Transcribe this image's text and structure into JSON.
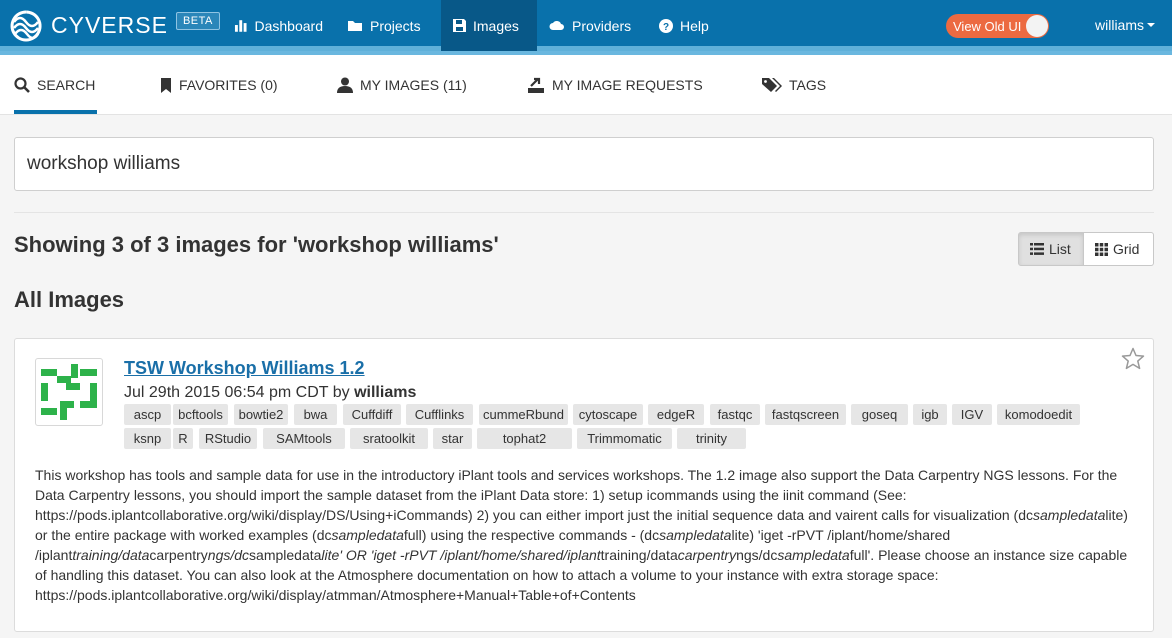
{
  "brand": {
    "name": "CYVERSE",
    "badge": "BETA"
  },
  "nav": {
    "items": [
      {
        "label": "Dashboard",
        "icon": "bar-chart-icon"
      },
      {
        "label": "Projects",
        "icon": "folder-icon"
      },
      {
        "label": "Images",
        "icon": "floppy-disk-icon",
        "active": true
      },
      {
        "label": "Providers",
        "icon": "cloud-icon"
      },
      {
        "label": "Help",
        "icon": "question-circle-icon"
      }
    ],
    "old_ui_label": "View Old UI",
    "user": "williams"
  },
  "tabs": [
    {
      "label": "SEARCH",
      "icon": "search-icon",
      "active": true
    },
    {
      "label": "FAVORITES (0)",
      "icon": "bookmark-icon"
    },
    {
      "label": "MY IMAGES (11)",
      "icon": "user-icon"
    },
    {
      "label": "MY IMAGE REQUESTS",
      "icon": "export-icon"
    },
    {
      "label": "TAGS",
      "icon": "tags-icon"
    }
  ],
  "search": {
    "value": "workshop williams"
  },
  "results": {
    "summary": "Showing 3 of 3 images for 'workshop williams'",
    "section_title": "All Images",
    "view_list_label": "List",
    "view_grid_label": "Grid"
  },
  "image_card": {
    "title": "TSW Workshop Williams 1.2",
    "date": "Jul 29th 2015 06:54 pm CDT",
    "by_label": "by",
    "author": "williams",
    "tags_row1": [
      "ascp",
      "bcftools",
      "bowtie2",
      "bwa",
      "Cuffdiff",
      "Cufflinks",
      "cummeRbund",
      "cytoscape",
      "edgeR",
      "fastqc",
      "fastqscreen",
      "goseq",
      "igb",
      "IGV",
      "komodoedit"
    ],
    "tags_row2": [
      "ksnp",
      "R",
      "RStudio",
      "SAMtools",
      "sratoolkit",
      "star",
      "tophat2",
      "Trimmomatic",
      "trinity"
    ],
    "description_parts": [
      {
        "text": "This workshop has tools and sample data for use in the introductory iPlant tools and services workshops. The 1.2 image also support the Data Carpentry NGS lessons. For the Data Carpentry lessons, you should import the sample dataset from the iPlant Data store: 1) setup icommands using the iinit command (See: https://pods.iplantcollaborative.org/wiki/display/DS/Using+iCommands) 2) you can either import just the initial sequence data and vairent calls for visualization (dc",
        "italic": false
      },
      {
        "text": "sampledata",
        "italic": true
      },
      {
        "text": "lite) or the entire package with worked examples (dc",
        "italic": false
      },
      {
        "text": "sampledata",
        "italic": true
      },
      {
        "text": "full) using the respective commands - (dc",
        "italic": false
      },
      {
        "text": "sampledata",
        "italic": true
      },
      {
        "text": "lite) 'iget -rPVT /iplant/home/shared /iplant",
        "italic": false
      },
      {
        "text": "training/data",
        "italic": true
      },
      {
        "text": "carpentry",
        "italic": false
      },
      {
        "text": "ngs/dc",
        "italic": true
      },
      {
        "text": "sampledata",
        "italic": false
      },
      {
        "text": "lite' OR 'iget -rPVT /iplant/home/shared/iplant",
        "italic": true
      },
      {
        "text": "training/data",
        "italic": false
      },
      {
        "text": "carpentry",
        "italic": true
      },
      {
        "text": "ngs/dc",
        "italic": false
      },
      {
        "text": "sampledata",
        "italic": true
      },
      {
        "text": "full'. Please choose an instance size capable of handling this dataset. You can also look at the Atmosphere documentation on how to attach a volume to your instance with extra storage space: https://pods.iplantcollaborative.org/wiki/display/atmman/Atmosphere+Manual+Table+of+Contents",
        "italic": false
      }
    ]
  },
  "colors": {
    "nav_bg": "#0971ab",
    "nav_active": "#085888",
    "old_ui_toggle": "#ec6a41",
    "link": "#1a6fa8",
    "logo_green": "#2db24a"
  }
}
